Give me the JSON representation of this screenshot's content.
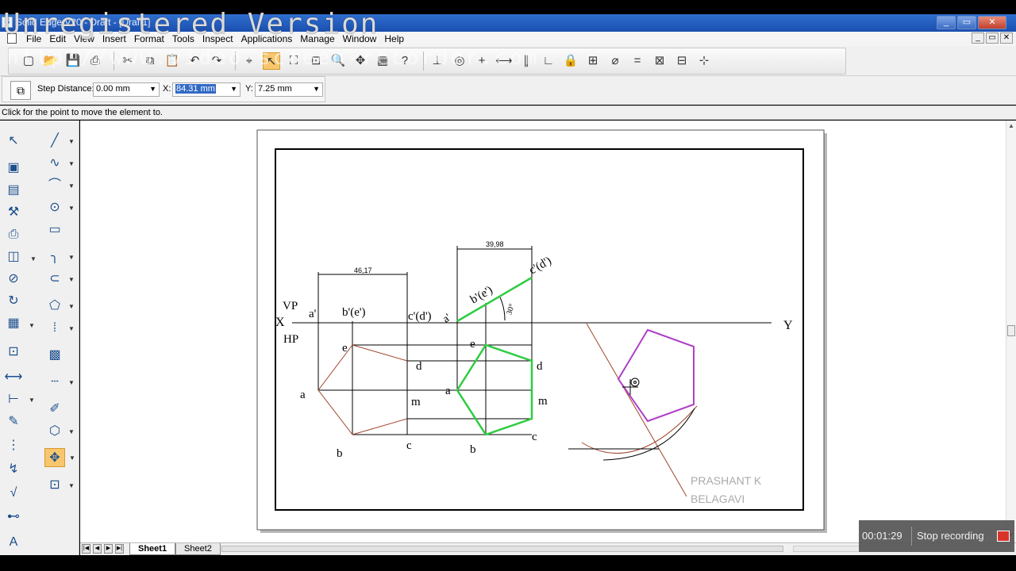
{
  "window": {
    "title": "Solid Edge V20 - Draft - [Draft1]",
    "controls": [
      "minimize",
      "restore",
      "close"
    ]
  },
  "menubar": {
    "items": [
      "File",
      "Edit",
      "View",
      "Insert",
      "Format",
      "Tools",
      "Inspect",
      "Applications",
      "Manage",
      "Window",
      "Help"
    ]
  },
  "ribbon": {
    "step_label": "Step Distance:",
    "step_value": "0.00 mm",
    "x_label": "X:",
    "x_value": "84.31 mm",
    "y_label": "Y:",
    "y_value": "7.25 mm"
  },
  "prompt": "Click for the point to move the element to.",
  "drawing": {
    "dim1": "46,17",
    "dim2": "39,98",
    "angle": "30°",
    "vp": "VP",
    "hp": "HP",
    "x": "X",
    "y": "Y",
    "labels": {
      "a_prime": "a'",
      "be_prime": "b'(e')",
      "cd_prime": "c'(d')",
      "a_prime2": "a'",
      "be_prime2": "b'(e')",
      "cd_prime2": "c'(d')",
      "e": "e",
      "d": "d",
      "a": "a",
      "m": "m",
      "b": "b",
      "c": "c",
      "e2": "e",
      "d2": "d",
      "a2": "a",
      "m2": "m",
      "b2": "b",
      "c2": "c"
    },
    "author_line1": "PRASHANT K",
    "author_line2": "BELAGAVI"
  },
  "sheets": [
    "Sheet1",
    "Sheet2"
  ],
  "recording": {
    "time": "00:01:29",
    "stop_label": "Stop recording"
  },
  "watermark": {
    "text": "Unregistered Version",
    "url": "http://www.video-screen-recorder.com"
  },
  "colors": {
    "green": "#2ecc40",
    "magenta": "#b040c8",
    "brown": "#a0442c",
    "titlebar": "#1a4fae",
    "highlight": "#f7c66d"
  }
}
